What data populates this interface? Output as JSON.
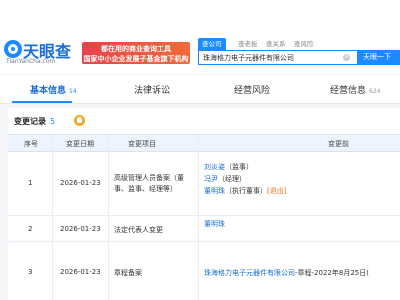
{
  "header": {
    "brand": "天眼查",
    "brand_url": "TianYanCha.com",
    "slogan_line1": "都在用的商业查询工具",
    "slogan_line2": "国家中小企业发展子基金旗下机构",
    "search_tabs": [
      "查公司",
      "查老板",
      "查关系",
      "查风险"
    ],
    "search_value": "珠海格力电子元器件有限公司",
    "search_button": "天眼一下"
  },
  "nav": {
    "items": [
      {
        "label": "基本信息",
        "count": "14"
      },
      {
        "label": "法律诉讼",
        "count": ""
      },
      {
        "label": "经营风险",
        "count": ""
      },
      {
        "label": "经营信息",
        "count": "624"
      }
    ]
  },
  "changes": {
    "title": "变更记录",
    "count": "5",
    "columns": [
      "序号",
      "变更日期",
      "变更项目",
      "变更前"
    ],
    "rows": [
      {
        "index": "1",
        "date": "2026-01-23",
        "item_line1": "高级管理人员备案（董",
        "item_line2": "事、监事、经理等）",
        "before": [
          {
            "name": "刘炎姿",
            "role": "（监事）",
            "tag": ""
          },
          {
            "name": "冯尹",
            "role": "（经理）",
            "tag": ""
          },
          {
            "name": "董明珠",
            "role": "（执行董事）",
            "tag": "[退出]"
          }
        ]
      },
      {
        "index": "2",
        "date": "2026-01-23",
        "item_line1": "法定代表人变更",
        "item_line2": "",
        "before": [
          {
            "name": "董明珠",
            "role": "",
            "tag": ""
          }
        ]
      },
      {
        "index": "3",
        "date": "2026-01-23",
        "item_line1": "章程备案",
        "item_line2": "",
        "before_text_link": "珠海格力电子元器件有限公司",
        "before_text_rest": "-章程-2022年8月25日("
      }
    ]
  }
}
